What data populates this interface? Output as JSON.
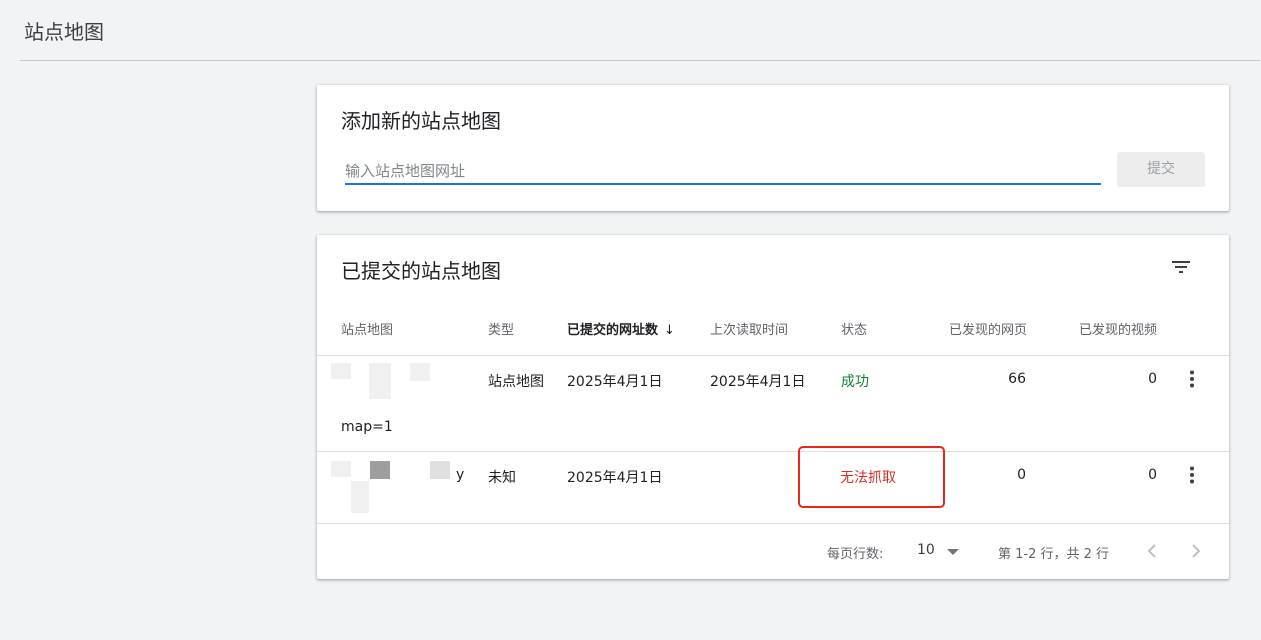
{
  "page": {
    "title": "站点地图"
  },
  "add_card": {
    "title": "添加新的站点地图",
    "input_placeholder": "输入站点地图网址",
    "input_value": "",
    "submit_label": "提交"
  },
  "list_card": {
    "title": "已提交的站点地图",
    "filter_icon": "filter-list-icon",
    "columns": {
      "sitemap": "站点地图",
      "type": "类型",
      "submitted": "已提交的网址数",
      "last_read": "上次读取时间",
      "status": "状态",
      "pages": "已发现的网页",
      "videos": "已发现的视频"
    },
    "rows": [
      {
        "sitemap_suffix": "map=1",
        "type": "站点地图",
        "submitted": "2025年4月1日",
        "last_read": "2025年4月1日",
        "status": "成功",
        "pages": "66",
        "videos": "0"
      },
      {
        "sitemap_suffix": "y",
        "type": "未知",
        "submitted": "2025年4月1日",
        "last_read": "",
        "status": "无法抓取",
        "pages": "0",
        "videos": "0"
      }
    ],
    "footer": {
      "rows_per_page_label": "每页行数:",
      "rows_per_page_value": "10",
      "range_text": "第 1-2 行，共 2 行"
    }
  },
  "colors": {
    "accent": "#1a73e8",
    "success": "#188038",
    "error": "#d93025",
    "highlight": "#e8261a"
  }
}
